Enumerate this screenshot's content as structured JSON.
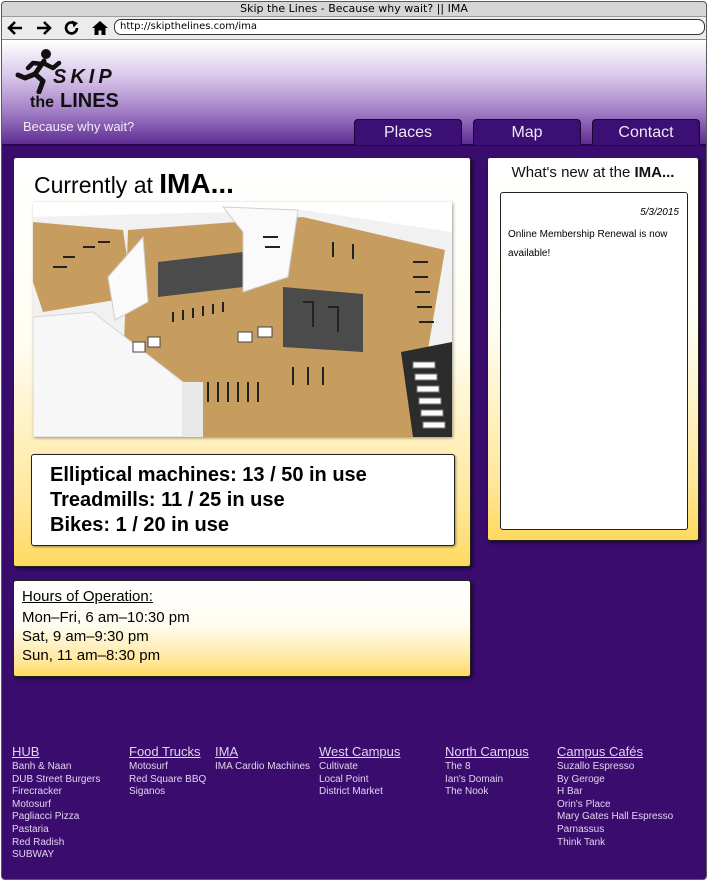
{
  "browser": {
    "title": "Skip the Lines - Because why wait? || IMA",
    "url": "http://skipthelines.com/ima"
  },
  "logo": {
    "skip": "SKIP",
    "the": "the",
    "lines": "LINES",
    "icon": "runner-icon"
  },
  "tagline": "Because why wait?",
  "nav": {
    "places": "Places",
    "map": "Map",
    "contact": "Contact"
  },
  "main": {
    "currently_prefix": "Currently at",
    "location": "IMA...",
    "usage": [
      "Elliptical machines: 13 / 50 in use",
      "Treadmills: 11 / 25 in use",
      "Bikes: 1 / 20 in use"
    ]
  },
  "whats_new": {
    "prefix": "What's new at the",
    "location": "IMA...",
    "date": "5/3/2015",
    "text": "Online Membership Renewal is now available!"
  },
  "hours": {
    "title": "Hours of Operation:",
    "lines": [
      "Mon–Fri, 6 am–10:30 pm",
      "Sat, 9 am–9:30 pm",
      "Sun, 11 am–8:30 pm"
    ]
  },
  "footer": {
    "hub": {
      "title": "HUB",
      "items": [
        "Banh & Naan",
        "DUB Street Burgers",
        "Firecracker",
        "Motosurf",
        "Pagliacci Pizza",
        "Pastaria",
        "Red Radish",
        "SUBWAY"
      ]
    },
    "food_trucks": {
      "title": "Food Trucks",
      "items": [
        "Motosurf",
        "Red Square BBQ",
        "Siganos"
      ]
    },
    "ima": {
      "title": "IMA",
      "items": [
        "IMA Cardio Machines"
      ]
    },
    "west_campus": {
      "title": "West Campus",
      "items": [
        "Cultivate",
        "Local Point",
        "District Market"
      ]
    },
    "north_campus": {
      "title": "North Campus",
      "items": [
        "The 8",
        "Ian's Domain",
        "The Nook"
      ]
    },
    "cafes": {
      "title": "Campus Cafés",
      "items": [
        "Suzallo Espresso",
        "By Geroge",
        "H Bar",
        "Orin's Place",
        "Mary Gates Hall Espresso",
        "Parnassus",
        "Think Tank"
      ]
    }
  },
  "colors": {
    "brand_purple": "#3a0c6e",
    "accent_gold": "#ffd95e"
  }
}
